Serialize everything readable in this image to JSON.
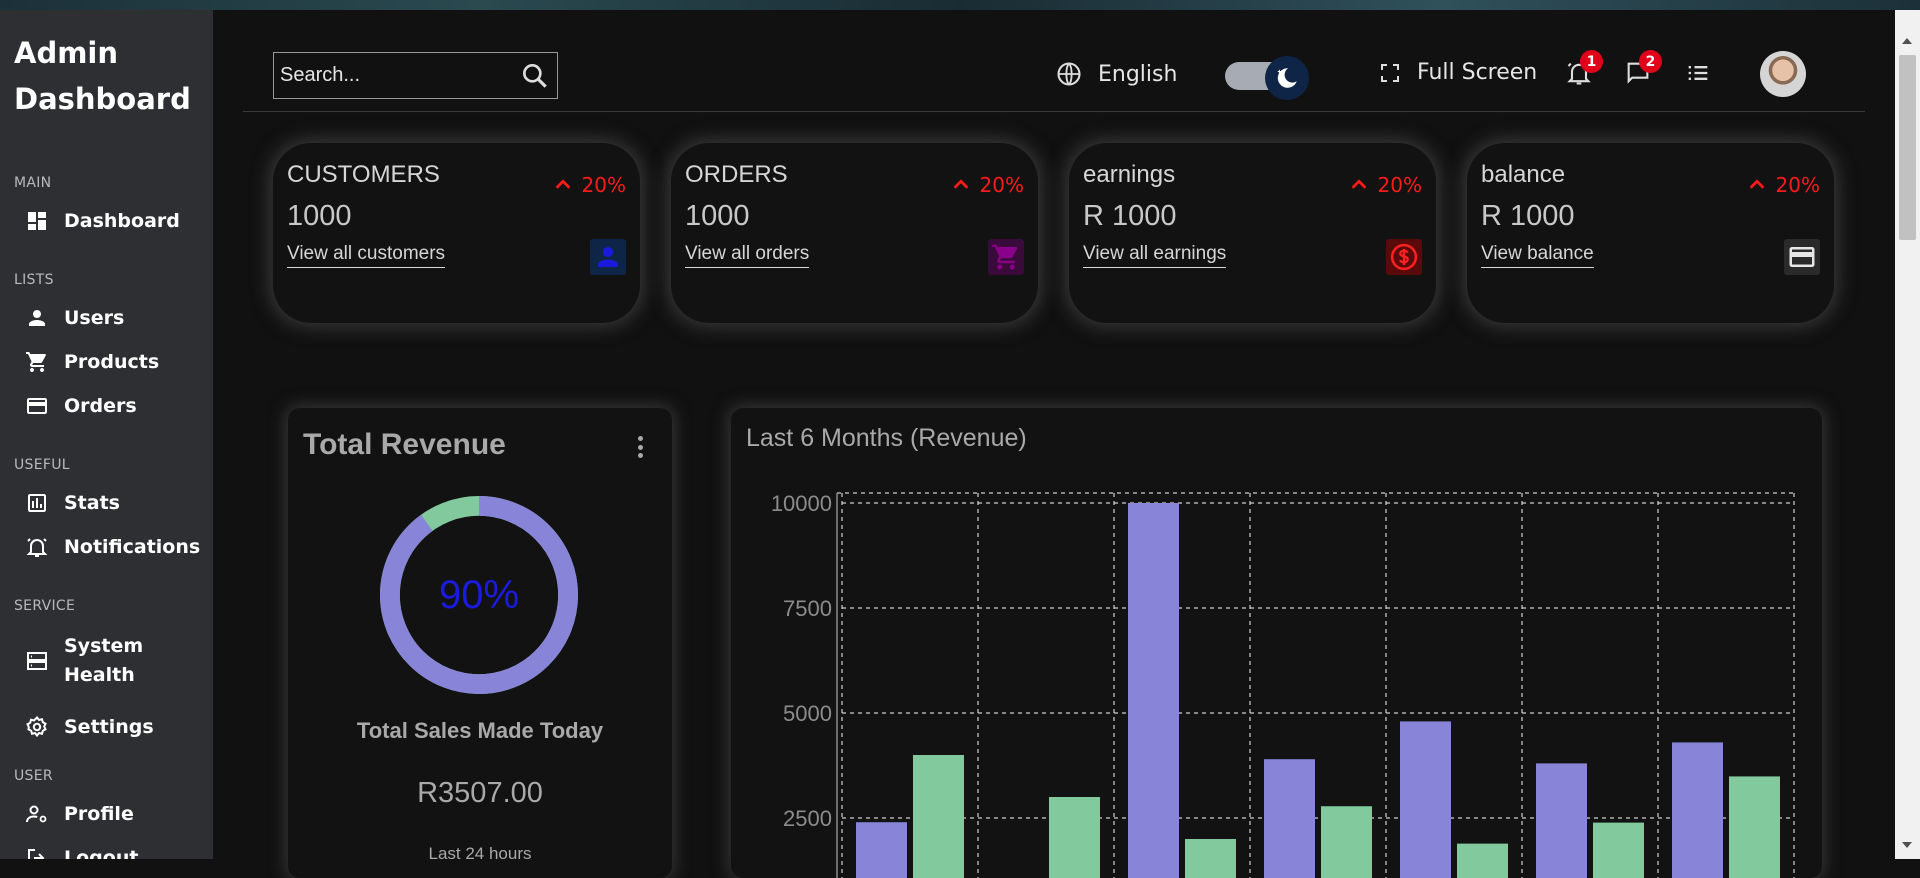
{
  "sidebar": {
    "logo": "Admin Dashboard",
    "sections": [
      {
        "title": "MAIN",
        "items": [
          {
            "label": "Dashboard",
            "icon": "dashboard-icon"
          }
        ]
      },
      {
        "title": "LISTS",
        "items": [
          {
            "label": "Users",
            "icon": "person-icon"
          },
          {
            "label": "Products",
            "icon": "cart-icon"
          },
          {
            "label": "Orders",
            "icon": "credit-card-icon"
          }
        ]
      },
      {
        "title": "USEFUL",
        "items": [
          {
            "label": "Stats",
            "icon": "chart-icon"
          },
          {
            "label": "Notifications",
            "icon": "bell-icon"
          }
        ]
      },
      {
        "title": "SERVICE",
        "items": [
          {
            "label": "System Health",
            "icon": "storage-icon"
          },
          {
            "label": "Settings",
            "icon": "gear-icon"
          }
        ]
      },
      {
        "title": "USER",
        "items": [
          {
            "label": "Profile",
            "icon": "profile-settings-icon"
          },
          {
            "label": "Logout",
            "icon": "logout-icon"
          }
        ]
      }
    ]
  },
  "navbar": {
    "search_placeholder": "Search...",
    "language": "English",
    "fullscreen": "Full Screen",
    "notifications_count": "1",
    "messages_count": "2",
    "theme": "dark"
  },
  "widgets": [
    {
      "title": "CUSTOMERS",
      "value": "1000",
      "link": "View all customers",
      "percent": "20%",
      "icon": "person-icon",
      "icon_color": "#1a1adc",
      "icon_bg": "#0f2547"
    },
    {
      "title": "ORDERS",
      "value": "1000",
      "link": "View all orders",
      "percent": "20%",
      "icon": "cart-icon",
      "icon_color": "#8a008a",
      "icon_bg": "#3a0a3a"
    },
    {
      "title": "earnings",
      "value": "R 1000",
      "link": "View all earnings",
      "percent": "20%",
      "icon": "dollar-icon",
      "icon_color": "#ff2020",
      "icon_bg": "#5a0a0a"
    },
    {
      "title": "balance",
      "value": "R 1000",
      "link": "View balance",
      "percent": "20%",
      "icon": "credit-card-icon",
      "icon_color": "#e6e6e6",
      "icon_bg": "#2a2a2a"
    }
  ],
  "revenue": {
    "title": "Total Revenue",
    "percent": "90%",
    "percent_value": 0.9,
    "subtitle": "Total Sales Made Today",
    "amount": "R3507.00",
    "period": "Last 24 hours",
    "ring_color": "#8884d8",
    "ring_rest_color": "#82ca9d"
  },
  "chart_data": {
    "type": "bar",
    "title": "Last 6 Months (Revenue)",
    "yticks": [
      "10000",
      "7500",
      "5000",
      "2500"
    ],
    "ylim": [
      0,
      10000
    ],
    "grid": true,
    "series": [
      {
        "color": "#8884d8",
        "values": [
          2400,
          null,
          10000,
          3900,
          4800,
          3800,
          4300
        ]
      },
      {
        "color": "#82ca9d",
        "values": [
          4000,
          3000,
          2000,
          2780,
          1890,
          2390,
          3490
        ]
      }
    ]
  }
}
